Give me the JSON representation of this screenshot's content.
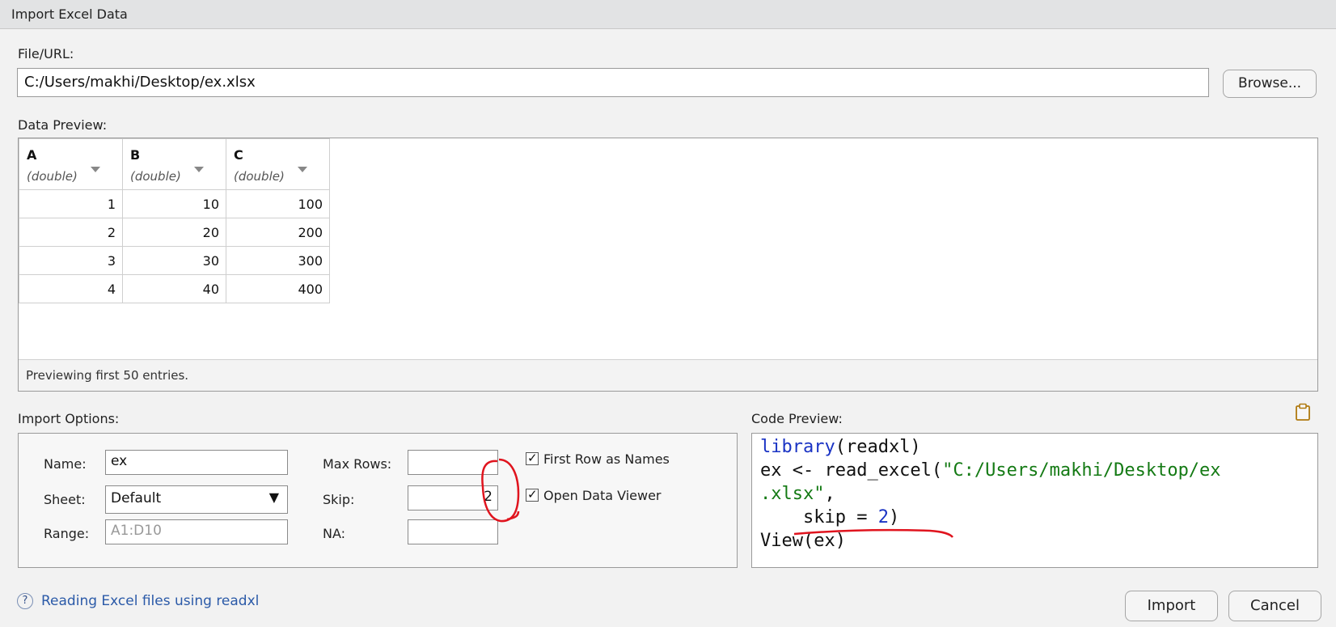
{
  "window": {
    "title": "Import Excel Data"
  },
  "file": {
    "label": "File/URL:",
    "value": "C:/Users/makhi/Desktop/ex.xlsx",
    "browse_label": "Browse..."
  },
  "preview": {
    "label": "Data Preview:",
    "columns": [
      {
        "name": "A",
        "type": "(double)"
      },
      {
        "name": "B",
        "type": "(double)"
      },
      {
        "name": "C",
        "type": "(double)"
      }
    ],
    "rows": [
      [
        "1",
        "10",
        "100"
      ],
      [
        "2",
        "20",
        "200"
      ],
      [
        "3",
        "30",
        "300"
      ],
      [
        "4",
        "40",
        "400"
      ]
    ],
    "footer": "Previewing first 50 entries."
  },
  "options": {
    "label": "Import Options:",
    "name_label": "Name:",
    "name_value": "ex",
    "sheet_label": "Sheet:",
    "sheet_value": "Default",
    "range_label": "Range:",
    "range_placeholder": "A1:D10",
    "max_rows_label": "Max Rows:",
    "max_rows_value": "",
    "skip_label": "Skip:",
    "skip_value": "2",
    "na_label": "NA:",
    "na_value": "",
    "first_row_label": "First Row as Names",
    "first_row_checked": true,
    "open_viewer_label": "Open Data Viewer",
    "open_viewer_checked": true
  },
  "code": {
    "label": "Code Preview:",
    "line1_fn": "library",
    "line1_rest": "(readxl)",
    "line2_a": "ex <- read_excel(",
    "line2_str": "\"C:/Users/makhi/Desktop/ex",
    "line3_str": ".xlsx\"",
    "line3_rest": ",",
    "line4_a": "    skip = ",
    "line4_num": "2",
    "line4_b": ")",
    "line5": "View(ex)"
  },
  "footer": {
    "help_link": "Reading Excel files using readxl",
    "import_label": "Import",
    "cancel_label": "Cancel"
  },
  "colors": {
    "annotation": "#e0141e",
    "keyword": "#1a33c4",
    "string": "#147a14"
  }
}
